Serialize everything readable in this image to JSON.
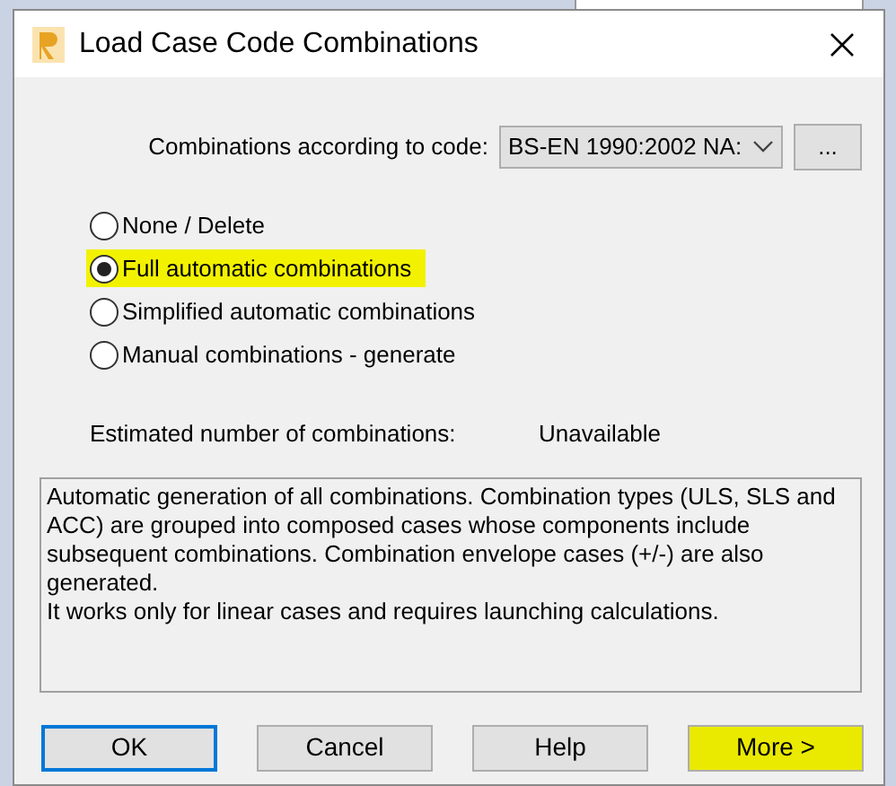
{
  "window": {
    "title": "Load Case Code Combinations"
  },
  "code": {
    "label": "Combinations according to code:",
    "value": "BS-EN 1990:2002 NA:",
    "browse": "..."
  },
  "options": [
    {
      "label": "None / Delete",
      "selected": false,
      "highlighted": false
    },
    {
      "label": "Full automatic combinations",
      "selected": true,
      "highlighted": true
    },
    {
      "label": "Simplified automatic combinations",
      "selected": false,
      "highlighted": false
    },
    {
      "label": "Manual combinations - generate",
      "selected": false,
      "highlighted": false
    }
  ],
  "estimate": {
    "label": "Estimated number of combinations:",
    "value": "Unavailable"
  },
  "description": [
    "Automatic generation of all combinations. Combination types (ULS, SLS and ACC) are grouped into composed cases whose components include subsequent combinations. Combination envelope cases (+/-) are also generated.",
    "It works only for linear cases and requires launching calculations."
  ],
  "buttons": [
    {
      "label": "OK",
      "default": true,
      "highlighted": false
    },
    {
      "label": "Cancel",
      "default": false,
      "highlighted": false
    },
    {
      "label": "Help",
      "default": false,
      "highlighted": false
    },
    {
      "label": "More >",
      "default": false,
      "highlighted": true
    }
  ]
}
